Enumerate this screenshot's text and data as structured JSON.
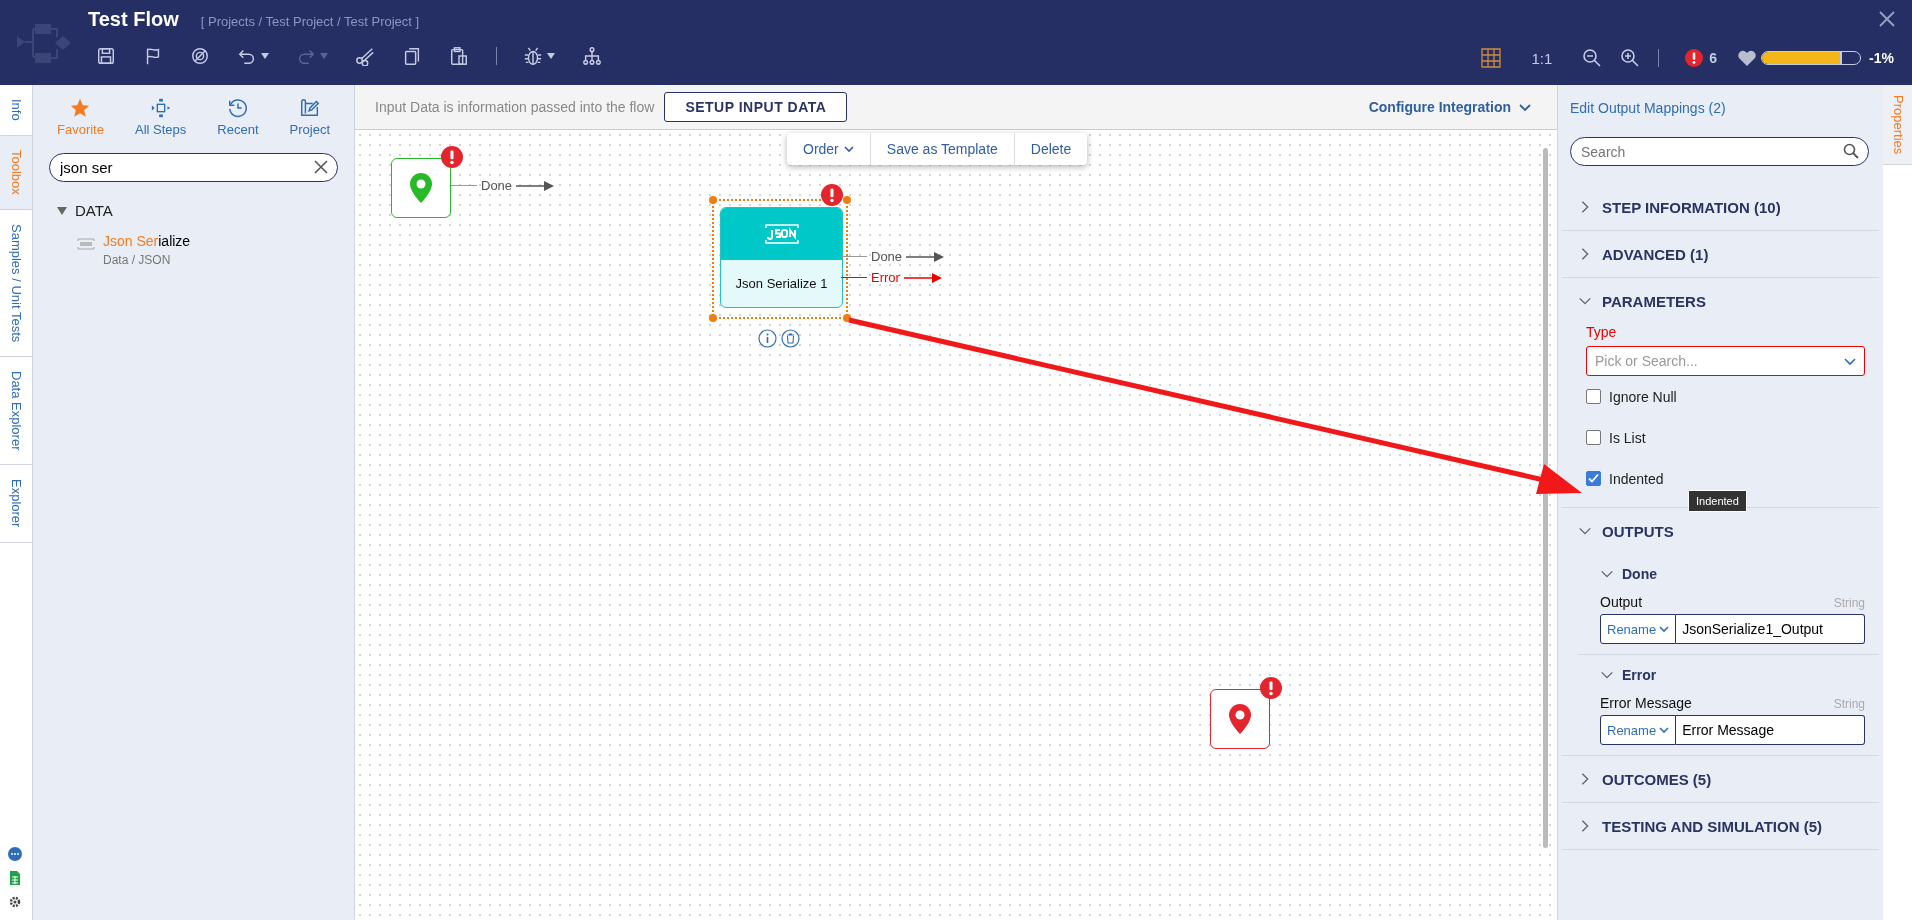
{
  "header": {
    "title": "Test Flow",
    "breadcrumb": "[ Projects / Test Project / Test Project ]",
    "toolbar": [
      {
        "kind": "save",
        "disabled": false,
        "dropdown": false
      },
      {
        "kind": "flag",
        "disabled": false,
        "dropdown": false
      },
      {
        "kind": "target",
        "disabled": false,
        "dropdown": false
      },
      {
        "kind": "undo",
        "disabled": false,
        "dropdown": true
      },
      {
        "kind": "redo",
        "disabled": true,
        "dropdown": true
      },
      {
        "kind": "cut",
        "disabled": false,
        "dropdown": false
      },
      {
        "kind": "copy",
        "disabled": false,
        "dropdown": false
      },
      {
        "kind": "paste",
        "disabled": false,
        "dropdown": false
      }
    ],
    "toolbar_debug": [
      {
        "kind": "debug",
        "disabled": false,
        "dropdown": true
      },
      {
        "kind": "tree",
        "disabled": false,
        "dropdown": false
      }
    ],
    "zoom_ratio": "1:1",
    "error_count": "6",
    "health": {
      "level": 0.8
    },
    "health_reading": "-1%"
  },
  "left_tabs": [
    {
      "label": "Info",
      "selected": false
    },
    {
      "label": "Toolbox",
      "selected": true
    },
    {
      "label": "Samples / Unit Tests",
      "selected": false
    },
    {
      "label": "Data Explorer",
      "selected": false
    },
    {
      "label": "Explorer",
      "selected": false
    }
  ],
  "toolbox": {
    "categories": [
      {
        "label": "Favorite",
        "kind": "star",
        "selected": true
      },
      {
        "label": "All Steps",
        "kind": "steps",
        "selected": false
      },
      {
        "label": "Recent",
        "kind": "clock",
        "selected": false
      },
      {
        "label": "Project",
        "kind": "blueprint",
        "selected": false
      }
    ],
    "search": {
      "value": "json ser"
    },
    "groups": [
      {
        "label": "DATA",
        "expanded": true,
        "items": [
          {
            "match": "Json Ser",
            "rest": "ialize",
            "path": "Data / JSON"
          }
        ]
      }
    ]
  },
  "canvas": {
    "info_text": "Input Data is information passed into the flow",
    "setup_button": "SETUP INPUT DATA",
    "configure": "Configure Integration",
    "context_menu": [
      {
        "label": "Order",
        "dropdown": true
      },
      {
        "label": "Save as Template",
        "dropdown": false
      },
      {
        "label": "Delete",
        "dropdown": false
      }
    ],
    "nodes": [
      {
        "kind": "start",
        "error": true,
        "selected": false,
        "outcomes": [
          {
            "label": "Done",
            "kind": "done"
          }
        ]
      },
      {
        "kind": "step",
        "title": "Json Serialize 1",
        "error": true,
        "selected": true,
        "outcomes": [
          {
            "label": "Done",
            "kind": "done"
          },
          {
            "label": "Error",
            "kind": "error"
          }
        ]
      },
      {
        "kind": "end",
        "error": true,
        "selected": false
      }
    ]
  },
  "properties": {
    "link": "Edit Output Mappings (2)",
    "search": {
      "placeholder": "Search"
    },
    "sections": [
      {
        "kind": "plain",
        "title": "STEP INFORMATION (10)",
        "expanded": false
      },
      {
        "kind": "plain",
        "title": "ADVANCED (1)",
        "expanded": false
      },
      {
        "kind": "parameters",
        "title": "PARAMETERS",
        "expanded": true,
        "type_field": {
          "label": "Type",
          "required": true,
          "placeholder": "Pick or Search..."
        },
        "checkboxes": [
          {
            "label": "Ignore Null",
            "checked": false
          },
          {
            "label": "Is List",
            "checked": false
          },
          {
            "label": "Indented",
            "checked": true,
            "tooltip": "Indented"
          }
        ]
      },
      {
        "kind": "outputs",
        "title": "OUTPUTS",
        "expanded": true,
        "groups": [
          {
            "title": "Done",
            "expanded": true,
            "fields": [
              {
                "label": "Output",
                "type": "String",
                "mode": "Rename",
                "value": "JsonSerialize1_Output"
              }
            ]
          },
          {
            "title": "Error",
            "expanded": true,
            "fields": [
              {
                "label": "Error Message",
                "type": "String",
                "mode": "Rename",
                "value": "Error Message"
              }
            ]
          }
        ]
      },
      {
        "kind": "plain",
        "title": "OUTCOMES (5)",
        "expanded": false
      },
      {
        "kind": "plain",
        "title": "TESTING AND SIMULATION (5)",
        "expanded": false
      }
    ]
  },
  "right_tabs": [
    {
      "label": "Properties",
      "selected": true
    }
  ]
}
